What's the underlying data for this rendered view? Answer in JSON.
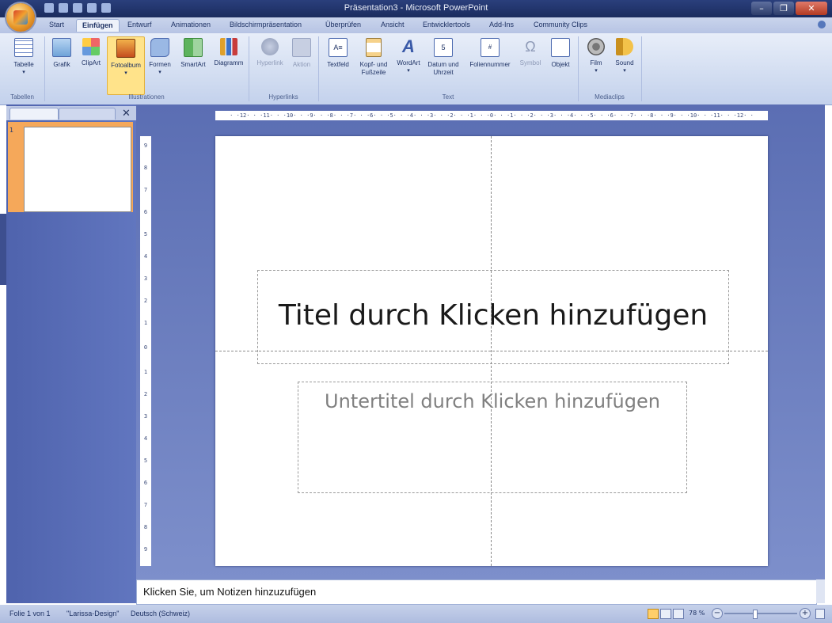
{
  "window": {
    "title": "Präsentation3 - Microsoft PowerPoint",
    "minimize": "–",
    "maximize": "❐",
    "close": "✕"
  },
  "tabs": [
    "Start",
    "Einfügen",
    "Entwurf",
    "Animationen",
    "Bildschirmpräsentation",
    "Überprüfen",
    "Ansicht",
    "Entwicklertools",
    "Add-Ins",
    "Community Clips"
  ],
  "active_tab": "Einfügen",
  "ribbon": {
    "tabelle": "Tabelle",
    "grafik": "Grafik",
    "clipart": "ClipArt",
    "fotoalbum": "Fotoalbum",
    "formen": "Formen",
    "smartart": "SmartArt",
    "diagramm": "Diagramm",
    "hyperlink": "Hyperlink",
    "aktion": "Aktion",
    "textfeld": "Textfeld",
    "kopf_fuss_1": "Kopf- und",
    "kopf_fuss_2": "Fußzeile",
    "wordart": "WordArt",
    "datum_1": "Datum und",
    "datum_2": "Uhrzeit",
    "foliennummer": "Foliennummer",
    "symbol": "Symbol",
    "objekt": "Objekt",
    "film": "Film",
    "sound": "Sound",
    "groups": {
      "tabellen": "Tabellen",
      "illustrationen": "Illustrationen",
      "hyperlinks": "Hyperlinks",
      "text": "Text",
      "mediaclips": "Mediaclips"
    }
  },
  "slides_pane": {
    "slide_number": "1"
  },
  "ruler": {
    "horizontal": "· ·12· · ·11· · ·10· · ·9· · ·8· · ·7· · ·6· · ·5· · ·4· · ·3· · ·2· · ·1· · ·0· · ·1· · ·2· · ·3· · ·4· · ·5· · ·6· · ·7· · ·8· · ·9· · ·10· · ·11· · ·12· ·",
    "vertical": [
      "9",
      "8",
      "7",
      "6",
      "5",
      "4",
      "3",
      "2",
      "1",
      "0",
      "1",
      "2",
      "3",
      "4",
      "5",
      "6",
      "7",
      "8",
      "9"
    ]
  },
  "slide": {
    "title_placeholder": "Titel durch Klicken hinzufügen",
    "subtitle_placeholder": "Untertitel durch Klicken hinzufügen"
  },
  "notes": {
    "placeholder": "Klicken Sie, um Notizen hinzuzufügen"
  },
  "status": {
    "slide": "Folie 1 von 1",
    "theme": "\"Larissa-Design\"",
    "language": "Deutsch (Schweiz)",
    "zoom": "78 %",
    "zoom_out": "−",
    "zoom_in": "+"
  },
  "colors": {
    "accent": "#ffe38a",
    "title_bar": "#1b2c5e",
    "background": "#6176bf"
  }
}
